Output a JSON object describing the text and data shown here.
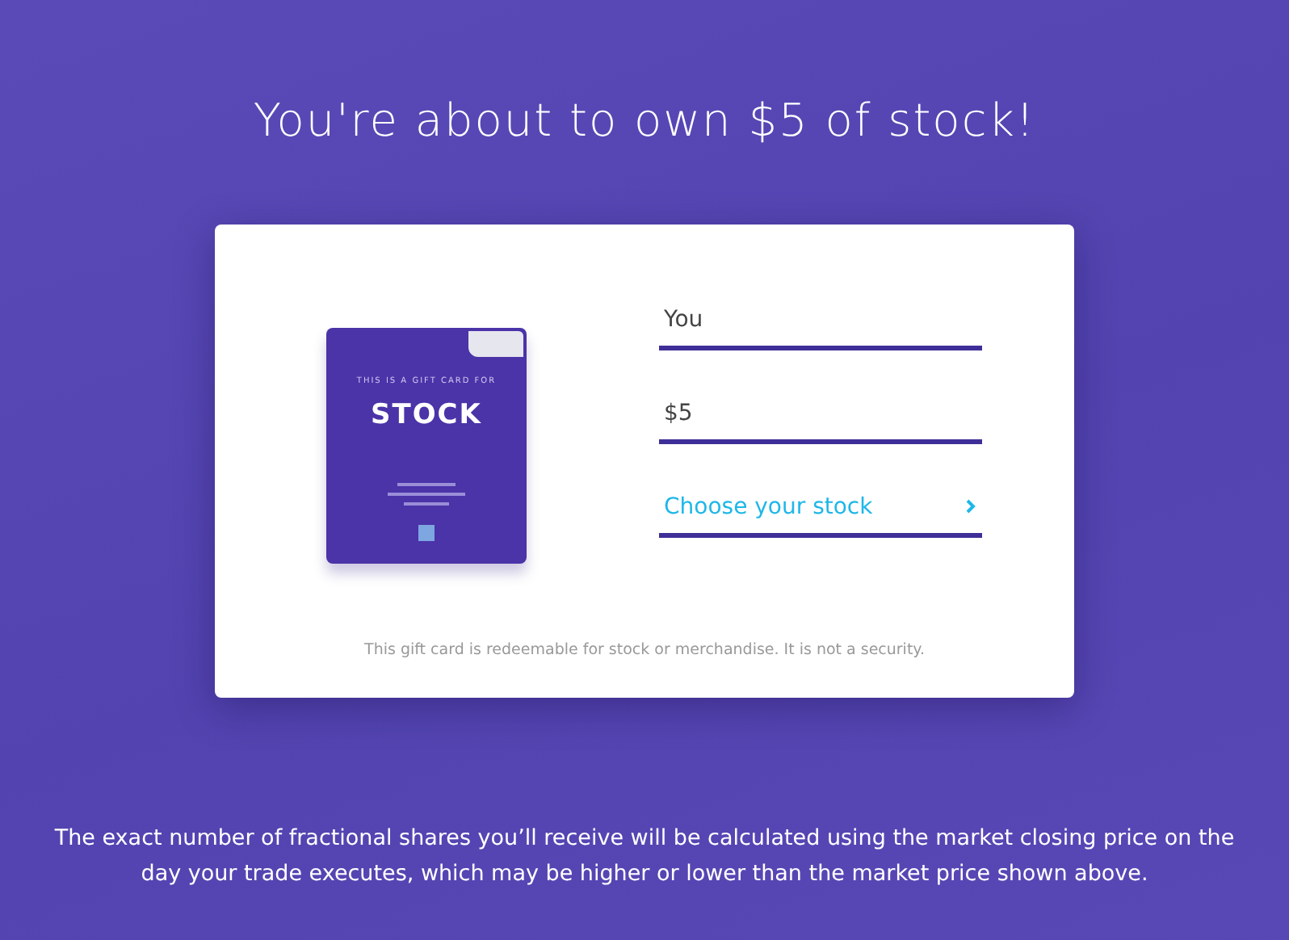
{
  "heading": "You're about to own $5 of stock!",
  "gift_card": {
    "caption": "THIS IS A GIFT CARD FOR",
    "title": "STOCK"
  },
  "fields": [
    {
      "kind": "text",
      "value": "You"
    },
    {
      "kind": "text",
      "value": "$5"
    },
    {
      "kind": "link",
      "value": "Choose your stock"
    }
  ],
  "disclaimer": "This gift card is redeemable for stock or merchandise. It is not a security.",
  "footnote": "The exact number of fractional shares you’ll receive will be calculated using the market closing price on the day your trade executes, which may be higher or lower than the market price shown above."
}
